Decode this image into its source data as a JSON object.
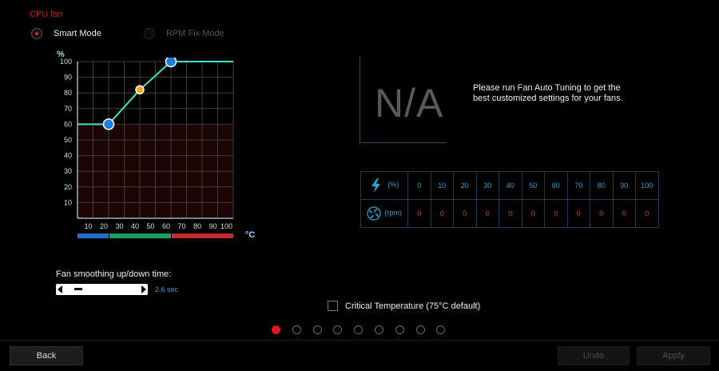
{
  "header": {
    "title": "CPU fan"
  },
  "mode": {
    "smart_label": "Smart Mode",
    "rpm_fix_label": "RPM Fix Mode",
    "selected": "smart"
  },
  "chart_data": {
    "type": "line",
    "y_unit": "%",
    "x_unit": "°C",
    "y_ticks": [
      "100",
      "90",
      "80",
      "70",
      "60",
      "50",
      "40",
      "30",
      "20",
      "10"
    ],
    "x_ticks": [
      "10",
      "20",
      "30",
      "40",
      "50",
      "60",
      "70",
      "80",
      "90",
      "100"
    ],
    "xlim": [
      0,
      100
    ],
    "ylim": [
      0,
      100
    ],
    "curve": {
      "x": [
        0,
        20,
        40,
        60,
        100
      ],
      "y": [
        60,
        60,
        82,
        100,
        100
      ],
      "color": "#3de8c8"
    },
    "points": [
      {
        "x": 20,
        "y": 60,
        "color": "#1e7fd8"
      },
      {
        "x": 40,
        "y": 82,
        "color": "#f5a623"
      },
      {
        "x": 60,
        "y": 100,
        "color": "#1e7fd8"
      }
    ],
    "zone_bar": [
      {
        "from": 0,
        "to": 20,
        "color": "#1f6fc8"
      },
      {
        "from": 20,
        "to": 60,
        "color": "#1aa05a"
      },
      {
        "from": 60,
        "to": 100,
        "color": "#c42a2a"
      }
    ],
    "grid": true
  },
  "info": {
    "na_text": "N/A",
    "message": "Please run Fan Auto Tuning to get the best customized settings for your fans."
  },
  "rpm_table": {
    "pct_label": "(%)",
    "rpm_label": "(rpm)",
    "columns": [
      "0",
      "10",
      "20",
      "30",
      "40",
      "50",
      "60",
      "70",
      "80",
      "90",
      "100"
    ],
    "rpm_values": [
      "0",
      "0",
      "0",
      "0",
      "0",
      "0",
      "0",
      "0",
      "0",
      "0",
      "0"
    ]
  },
  "smoothing": {
    "label": "Fan smoothing up/down time:",
    "value": "2.6 sec",
    "level": 0.12
  },
  "critical": {
    "label": "Critical Temperature (75°C default)",
    "checked": false
  },
  "pager": {
    "count": 9,
    "active": 0
  },
  "footer": {
    "back_label": "Back",
    "undo_label": "Undo",
    "apply_label": "Apply"
  },
  "colors": {
    "accent": "#d21e1e",
    "info_blue": "#2ea3d6",
    "rpm_red": "#e83a2e"
  }
}
